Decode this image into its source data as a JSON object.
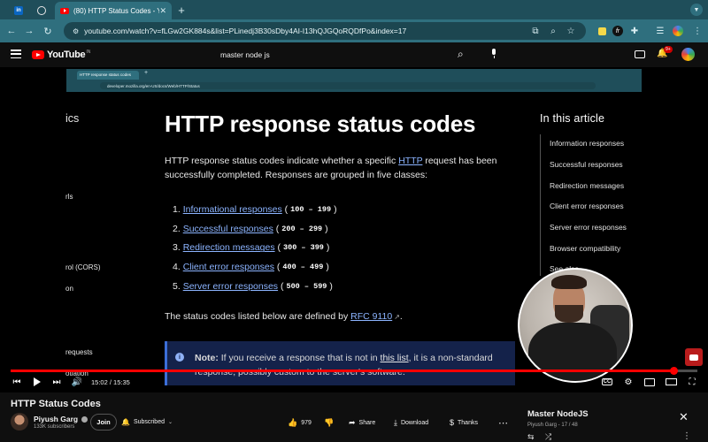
{
  "browser": {
    "tab_title": "(80) HTTP Status Codes - Yo",
    "url": "youtube.com/watch?v=fLGw2GK884s&list=PLinedj3B30sDby4AI-I13hQJGQoRQDfPo&index=17",
    "extension_badge": "",
    "colors": {
      "tabstrip": "#1f4e5a",
      "toolbar": "#2f6f7e"
    }
  },
  "youtube": {
    "logo_word": "YouTube",
    "logo_country": "IN",
    "search_value": "master node js",
    "notifications_badge": "9+",
    "brand_color": "#ff0000"
  },
  "video_content": {
    "inner_tab_title": "HTTP response status codes",
    "inner_url": "developer.mozilla.org/en-US/docs/Web/HTTP/Status",
    "sidebar_fragments": [
      "ics",
      "rls",
      "rol (CORS)",
      "on",
      "requests",
      "otiation"
    ],
    "heading": "HTTP response status codes",
    "intro_before_link": "HTTP response status codes indicate whether a specific ",
    "intro_link": "HTTP",
    "intro_after_link": " request has been",
    "intro_line2": "successfully completed. Responses are grouped in five classes:",
    "classes": [
      {
        "num": "1.",
        "label": "Informational responses",
        "range": "100 – 199"
      },
      {
        "num": "2.",
        "label": "Successful responses",
        "range": "200 – 299"
      },
      {
        "num": "3.",
        "label": "Redirection messages",
        "range": "300 – 399"
      },
      {
        "num": "4.",
        "label": "Client error responses",
        "range": "400 – 499"
      },
      {
        "num": "5.",
        "label": "Server error responses",
        "range": "500 – 599"
      }
    ],
    "defined_before": "The status codes listed below are defined by ",
    "defined_link": "RFC 9110",
    "defined_after": ".",
    "note_label": "Note:",
    "note_before": " If you receive a response that is not in ",
    "note_link": "this list",
    "note_after": ", it is a non-standard",
    "note_line2": "response, possibly custom to the server's software.",
    "toc_title": "In this article",
    "toc_items": [
      "Information responses",
      "Successful responses",
      "Redirection messages",
      "Client error responses",
      "Server error responses",
      "Browser compatibility",
      "See also"
    ]
  },
  "player": {
    "current_time": "15:02",
    "duration": "15:35",
    "progress_fraction": 0.965,
    "separator": " / "
  },
  "video_info": {
    "title": "HTTP Status Codes",
    "channel": "Piyush Garg",
    "subscribers": "133K subscribers",
    "join_label": "Join",
    "subscribed_label": "Subscribed",
    "likes": "979",
    "share_label": "Share",
    "download_label": "Download",
    "thanks_label": "Thanks"
  },
  "playlist": {
    "title": "Master NodeJS",
    "owner": "Piyush Garg",
    "position": "17 / 48",
    "separator": " - "
  }
}
